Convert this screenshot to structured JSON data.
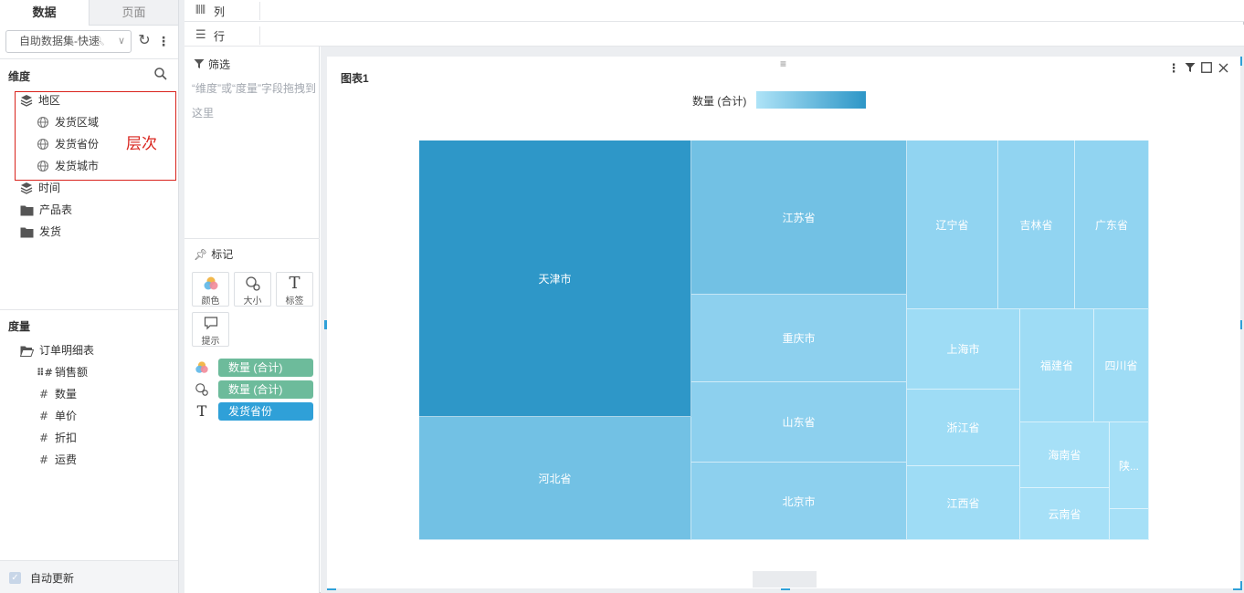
{
  "tabs": {
    "data": "数据",
    "page": "页面"
  },
  "dataset": {
    "selected": "自助数据集-快速"
  },
  "dimensions": {
    "title": "维度",
    "hierarchy_label": "层次",
    "items": [
      {
        "label": "地区",
        "icon": "layers-icon"
      },
      {
        "label": "发货区域",
        "icon": "globe-icon"
      },
      {
        "label": "发货省份",
        "icon": "globe-icon"
      },
      {
        "label": "发货城市",
        "icon": "globe-icon"
      },
      {
        "label": "时间",
        "icon": "layers-icon"
      },
      {
        "label": "产品表",
        "icon": "folder-icon"
      },
      {
        "label": "发货",
        "icon": "folder-icon"
      }
    ]
  },
  "measures": {
    "title": "度量",
    "table": "订单明细表",
    "items": [
      "销售额",
      "数量",
      "单价",
      "折扣",
      "运费"
    ]
  },
  "auto_update": "自动更新",
  "shelves": {
    "columns": "列",
    "rows": "行"
  },
  "filter": {
    "title": "筛选",
    "hint": "“维度”或“度量”字段拖拽到这里"
  },
  "marks": {
    "title": "标记",
    "buttons": {
      "color": "颜色",
      "size": "大小",
      "label": "标签",
      "tooltip": "提示"
    },
    "pills": [
      {
        "label": "数量 (合计)",
        "kind": "color",
        "color": "#6dbb9b"
      },
      {
        "label": "数量 (合计)",
        "kind": "size",
        "color": "#6dbb9b"
      },
      {
        "label": "发货省份",
        "kind": "label",
        "color": "#2fa0d8"
      }
    ]
  },
  "chart": {
    "title": "图表1",
    "legend_label": "数量 (合计)",
    "accent": "#2fa0d8"
  },
  "chart_data": {
    "type": "treemap",
    "color_measure": "数量 (合计)",
    "cells": [
      {
        "name": "天津市",
        "color": "#2e97c8"
      },
      {
        "name": "河北省",
        "color": "#72c1e4"
      },
      {
        "name": "江苏省",
        "color": "#72c1e4"
      },
      {
        "name": "重庆市",
        "color": "#8dd0ee"
      },
      {
        "name": "山东省",
        "color": "#8dd0ee"
      },
      {
        "name": "北京市",
        "color": "#8dd0ee"
      },
      {
        "name": "辽宁省",
        "color": "#91d4f1"
      },
      {
        "name": "吉林省",
        "color": "#91d4f1"
      },
      {
        "name": "广东省",
        "color": "#91d4f1"
      },
      {
        "name": "上海市",
        "color": "#9edcf5"
      },
      {
        "name": "浙江省",
        "color": "#9edcf5"
      },
      {
        "name": "江西省",
        "color": "#9edcf5"
      },
      {
        "name": "福建省",
        "color": "#9edcf5"
      },
      {
        "name": "四川省",
        "color": "#9edcf5"
      },
      {
        "name": "海南省",
        "color": "#a6e0f7"
      },
      {
        "name": "云南省",
        "color": "#a6e0f7"
      },
      {
        "name": "陕...",
        "color": "#a6e0f7"
      },
      {
        "name": "",
        "color": "#a6e0f7"
      }
    ]
  }
}
